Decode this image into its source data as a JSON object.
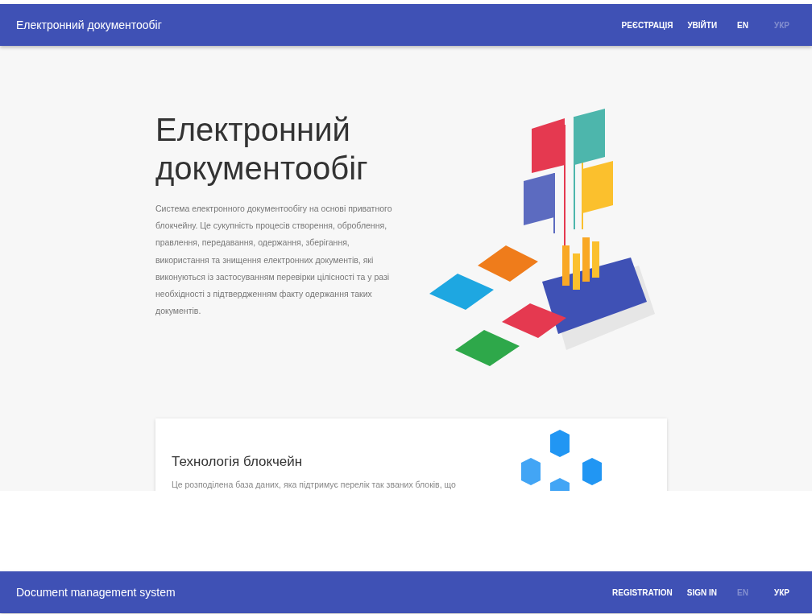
{
  "screens": [
    {
      "app_bar": {
        "title": "Електронний документообіг",
        "actions": [
          "РЕЄСТРАЦІЯ",
          "УВІЙТИ"
        ],
        "languages": [
          {
            "label": "EN",
            "selected": false
          },
          {
            "label": "УКР",
            "selected": true
          }
        ]
      },
      "hero": {
        "title": "Електронний документообіг",
        "text": "Система електронного документообігу на основі приватного блокчейну. Це сукупність процесів створення, оброблення, правлення, передавання, одержання, зберігання, використання та знищення електронних документів, які виконуються із застосуванням перевірки цілісності та у разі необхідності з підтвердженням факту одержання таких документів."
      },
      "card": {
        "title": "Технологія блокчейн",
        "text": "Це розподілена база даних, яка підтримує перелік так званих блоків, що"
      }
    },
    {
      "app_bar": {
        "title": "Document management system",
        "actions": [
          "REGISTRATION",
          "SIGN IN"
        ],
        "languages": [
          {
            "label": "EN",
            "selected": true
          },
          {
            "label": "УКР",
            "selected": false
          }
        ]
      }
    }
  ]
}
